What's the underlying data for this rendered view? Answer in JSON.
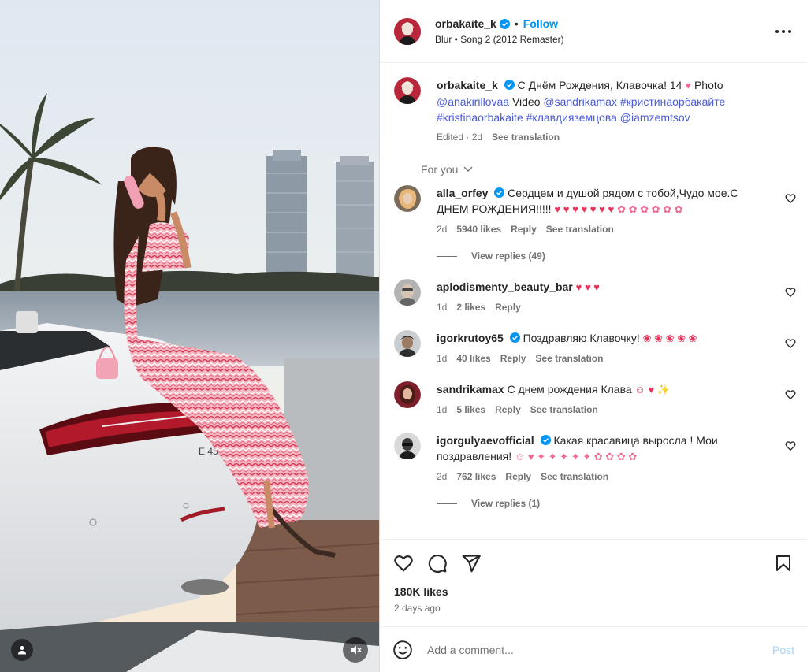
{
  "post_author": {
    "username": "orbakaite_k",
    "follow_label": "Follow",
    "dot": "•",
    "music": "Blur • Song 2 (2012 Remaster)"
  },
  "caption": {
    "username": "orbakaite_k",
    "text_1": "С Днём Рождения, Клавочка! 14",
    "heart": "♥",
    "text_2": "Photo",
    "mention_1": "@anakirillovaa",
    "text_3": "Video",
    "mention_2": "@sandrikamax",
    "hashtag_1": "#кристинаорбакайте",
    "hashtag_2": "#kristinaorbakaite",
    "hashtag_3": "#клавдияземцова",
    "mention_3": "@iamzemtsov",
    "edited": "Edited · 2d",
    "see_translation": "See translation"
  },
  "for_you_label": "For you",
  "comments": [
    {
      "username": "alla_orfey",
      "verified": true,
      "text": "Сердцем и душой рядом с тобой,Чудо мое.С ДНЕМ РОЖДЕНИЯ!!!!!",
      "emoji_hearts": "♥ ♥ ♥ ♥ ♥ ♥ ♥",
      "emoji_flowers": "✿ ✿ ✿ ✿ ✿ ✿",
      "age": "2d",
      "likes": "5940 likes",
      "reply": "Reply",
      "see_translation": "See translation",
      "view_replies": "View replies (49)"
    },
    {
      "username": "aplodismenty_beauty_bar",
      "verified": false,
      "text": "",
      "emoji_hearts": "♥ ♥ ♥",
      "age": "1d",
      "likes": "2 likes",
      "reply": "Reply"
    },
    {
      "username": "igorkrutoy65",
      "verified": true,
      "text": "Поздравляю Клавочку!",
      "emoji_roses": "❀ ❀ ❀ ❀ ❀",
      "age": "1d",
      "likes": "40 likes",
      "reply": "Reply",
      "see_translation": "See translation"
    },
    {
      "username": "sandrikamax",
      "verified": false,
      "text": "С днем рождения Клава",
      "emoji": "☺ ♥ ✨",
      "age": "1d",
      "likes": "5 likes",
      "reply": "Reply",
      "see_translation": "See translation"
    },
    {
      "username": "igorgulyaevofficial",
      "verified": true,
      "text": "Какая красавица выросла ! Мои поздравления!",
      "emoji": "☺ ♥ ✦ ✦ ✦ ✦ ✦ ✿ ✿ ✿ ✿",
      "age": "2d",
      "likes": "762 likes",
      "reply": "Reply",
      "see_translation": "See translation",
      "view_replies": "View replies (1)"
    }
  ],
  "likes_count": "180K likes",
  "posted_ago": "2 days ago",
  "comment_box": {
    "placeholder": "Add a comment...",
    "post_label": "Post"
  },
  "media": {
    "plate_text": "E 450"
  },
  "colors": {
    "accent_blue": "#0095f6",
    "link_blue": "#4a5bd6",
    "verified_blue": "#0095f6",
    "heart_red": "#e8345b",
    "muted_text": "#737373"
  }
}
